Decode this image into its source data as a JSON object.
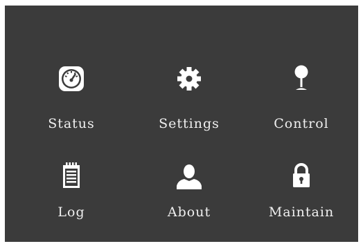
{
  "menu": {
    "items": [
      {
        "id": "status",
        "label": "Status",
        "icon": "gauge-icon"
      },
      {
        "id": "settings",
        "label": "Settings",
        "icon": "gear-icon"
      },
      {
        "id": "control",
        "label": "Control",
        "icon": "joystick-icon"
      },
      {
        "id": "log",
        "label": "Log",
        "icon": "notepad-icon"
      },
      {
        "id": "about",
        "label": "About",
        "icon": "person-icon"
      },
      {
        "id": "maintain",
        "label": "Maintain",
        "icon": "lock-icon"
      }
    ]
  },
  "colors": {
    "screen_bg": "#3b3b3b",
    "icon": "#ffffff",
    "text": "#f0f0f0"
  }
}
